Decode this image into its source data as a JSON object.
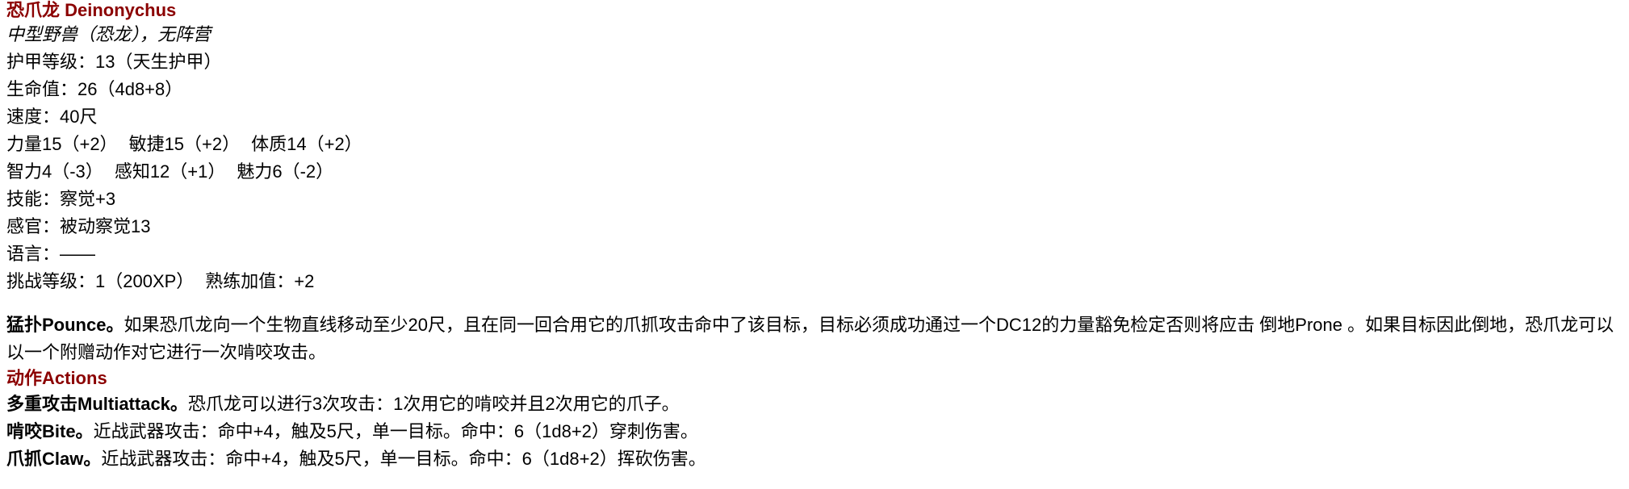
{
  "creature": {
    "name": "恐爪龙 Deinonychus",
    "type": "中型野兽（恐龙），无阵营",
    "armor_class": "护甲等级：13（天生护甲）",
    "hit_points": "生命值：26（4d8+8）",
    "speed": "速度：40尺",
    "abilities_row1": [
      "力量15（+2）",
      "敏捷15（+2）",
      "体质14（+2）"
    ],
    "abilities_row2": [
      "智力4（-3）",
      "感知12（+1）",
      "魅力6（-2）"
    ],
    "skills": "技能：察觉+3",
    "senses": "感官：被动察觉13",
    "languages": "语言：——",
    "challenge": [
      "挑战等级：1（200XP）",
      "熟练加值：+2"
    ]
  },
  "traits": [
    {
      "name": "猛扑Pounce。",
      "text": "如果恐爪龙向一个生物直线移动至少20尺，且在同一回合用它的爪抓攻击命中了该目标，目标必须成功通过一个DC12的力量豁免检定否则将应击 倒地Prone 。如果目标因此倒地，恐爪龙可以以一个附赠动作对它进行一次啃咬攻击。"
    }
  ],
  "actions_heading": "动作Actions",
  "actions": [
    {
      "name": "多重攻击Multiattack。",
      "text": "恐爪龙可以进行3次攻击：1次用它的啃咬并且2次用它的爪子。"
    },
    {
      "name": "啃咬Bite。",
      "text": "近战武器攻击：命中+4，触及5尺，单一目标。命中：6（1d8+2）穿刺伤害。"
    },
    {
      "name": "爪抓Claw。",
      "text": "近战武器攻击：命中+4，触及5尺，单一目标。命中：6（1d8+2）挥砍伤害。"
    }
  ],
  "colors": {
    "heading": "#8b0000",
    "text": "#000000",
    "background": "#ffffff"
  }
}
